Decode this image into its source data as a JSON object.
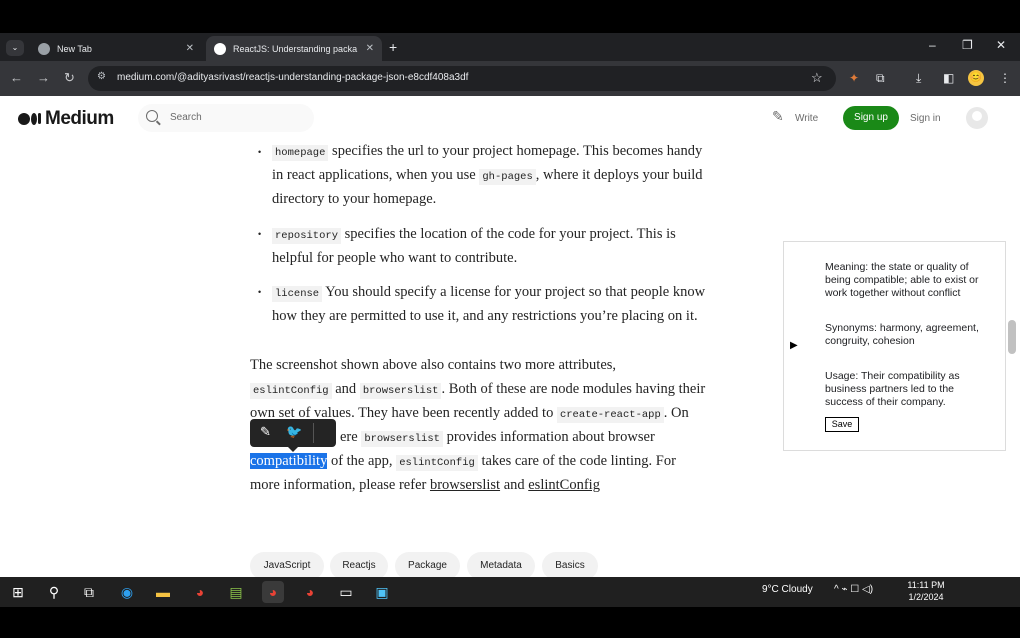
{
  "browser": {
    "tabs": [
      {
        "title": "New Tab",
        "active": false
      },
      {
        "title": "ReactJS: Understanding packa",
        "active": true
      }
    ],
    "url": "medium.com/@adityasrivast/reactjs-understanding-package-json-e8cdf408a3df",
    "controls": {
      "minimize": "–",
      "maximize": "❐",
      "close": "✕",
      "new_tab": "+",
      "tab_close": "✕",
      "tab_list": "⌄"
    },
    "nav": {
      "back": "←",
      "forward": "→",
      "reload": "↻",
      "star": "☆",
      "site_info": "⚙"
    },
    "toolbar_icons": {
      "extension": "⧉",
      "puzzle": "✦",
      "download": "⤓",
      "sidebar": "◧",
      "menu": "⋮"
    },
    "profile_glyph": "😊"
  },
  "medium": {
    "logo_text": "Medium",
    "search_placeholder": "Search",
    "write_icon": "✎",
    "write_label": "Write",
    "signup_label": "Sign up",
    "signin_label": "Sign in"
  },
  "article": {
    "bullet_char": "•",
    "homepage": {
      "code": "homepage",
      "l1_rest": " specifies the url to your project homepage. This becomes handy",
      "l2_pre": "in react applications, when you use ",
      "l2_code": "gh-pages",
      "l2_post": ", where it deploys your build",
      "l3": "directory to your homepage."
    },
    "repository": {
      "code": "repository",
      "l1_rest": " specifies the location of the code for your project. This is",
      "l2": "helpful for people who want to contribute."
    },
    "license": {
      "code": "license",
      "l1_rest": " You should specify a license for your project so that people know",
      "l2": "how they are permitted to use it, and any restrictions you’re placing on it."
    },
    "para": {
      "l1": "The screenshot shown above also contains two more attributes,",
      "l2_code1": "eslintConfig",
      "l2_and": " and ",
      "l2_code2": "browserslist",
      "l2_rest": ". Both of these are node modules having their",
      "l3_text": "own set of values. They have been recently added to ",
      "l3_code": "create-react-app",
      "l3_rest": ". On",
      "l4_text": "ere ",
      "l4_code": "browserslist",
      "l4_rest": " provides information about browser",
      "l5_highlight": "compatibility",
      "l5_text": " of the app, ",
      "l5_code": "eslintConfig",
      "l5_rest": " takes care of the code linting. For",
      "l6_text": "more information, please refer ",
      "l6_link1": "browserslist",
      "l6_and": " and ",
      "l6_link2": "eslintConfig"
    },
    "highlight_menu": {
      "edit_icon": "✎",
      "twitter_icon": "🐦"
    }
  },
  "definition": {
    "play_icon": "▶",
    "meaning": "Meaning: the state or quality of being compatible; able to exist or work together without conflict",
    "synonyms": "Synonyms: harmony, agreement, congruity, cohesion",
    "usage": "Usage: Their compatibility as business partners led to the success of their company.",
    "save_label": "Save"
  },
  "tags": [
    "JavaScript",
    "Reactjs",
    "Package",
    "Metadata",
    "Basics"
  ],
  "taskbar": {
    "icons": {
      "start": "⊞",
      "search": "⚲",
      "taskview": "⧉",
      "edge": "◉",
      "explorer": "▬",
      "chrome": "◕",
      "notepad": "▤",
      "chrome2": "◕",
      "chrome3": "◕",
      "terminal": "▭",
      "app": "▣"
    },
    "weather": "9°C  Cloudy",
    "tray": "^  ⌁  ☐  ◁)",
    "time": "11:11 PM",
    "date": "1/2/2024"
  },
  "colors": {
    "accent": "#1a8917",
    "highlight": "#1a73e8",
    "chrome_dark": "#202124",
    "chrome_toolbar": "#35363a"
  }
}
